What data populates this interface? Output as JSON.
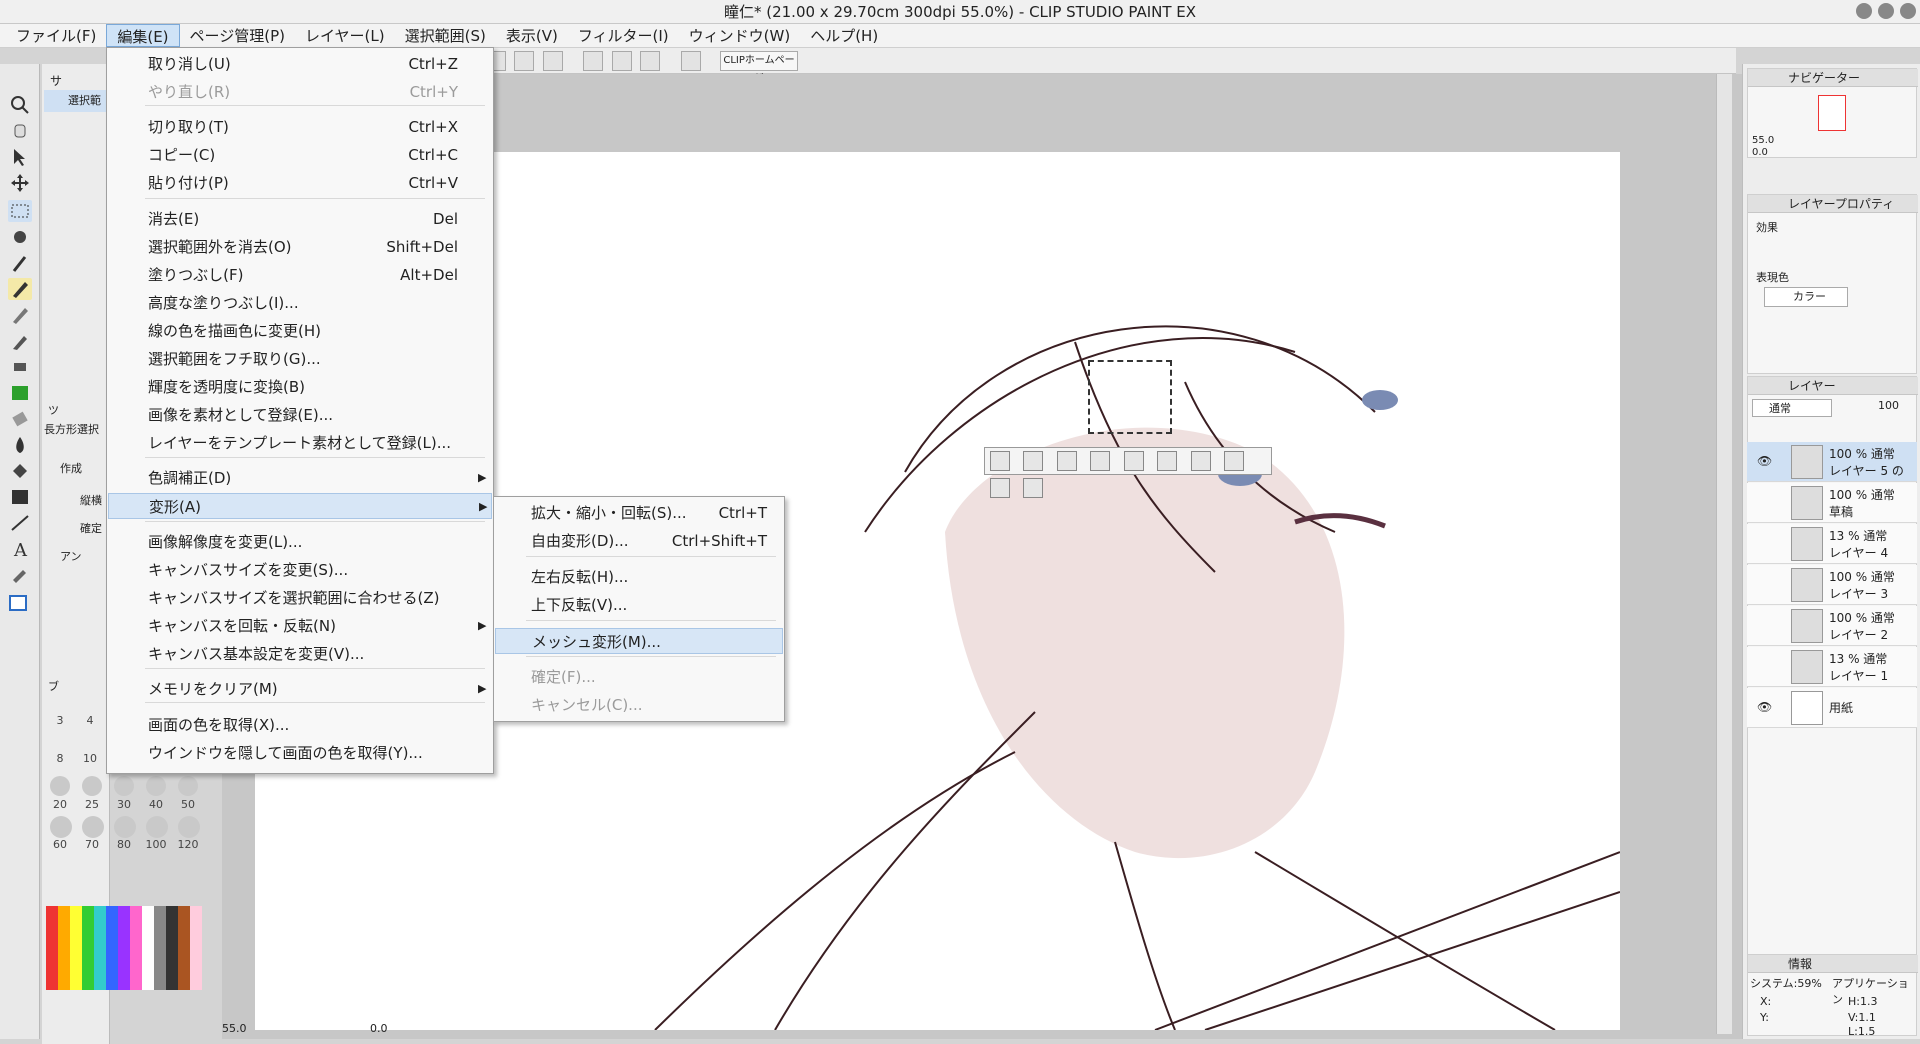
{
  "window": {
    "title": "瞳仁* (21.00 x 29.70cm 300dpi 55.0%)  - CLIP STUDIO PAINT EX"
  },
  "menubar": [
    {
      "label": "ファイル(F)"
    },
    {
      "label": "編集(E)"
    },
    {
      "label": "ページ管理(P)"
    },
    {
      "label": "レイヤー(L)"
    },
    {
      "label": "選択範囲(S)"
    },
    {
      "label": "表示(V)"
    },
    {
      "label": "フィルター(I)"
    },
    {
      "label": "ウィンドウ(W)"
    },
    {
      "label": "ヘルプ(H)"
    }
  ],
  "toolbar": {
    "clip_button": "CLIPホームページ"
  },
  "edit_menu": [
    {
      "label": "取り消し(U)",
      "shortcut": "Ctrl+Z"
    },
    {
      "label": "やり直し(R)",
      "shortcut": "Ctrl+Y"
    },
    {
      "label": "切り取り(T)",
      "shortcut": "Ctrl+X"
    },
    {
      "label": "コピー(C)",
      "shortcut": "Ctrl+C"
    },
    {
      "label": "貼り付け(P)",
      "shortcut": "Ctrl+V"
    },
    {
      "label": "消去(E)",
      "shortcut": "Del"
    },
    {
      "label": "選択範囲外を消去(O)",
      "shortcut": "Shift+Del"
    },
    {
      "label": "塗りつぶし(F)",
      "shortcut": "Alt+Del"
    },
    {
      "label": "高度な塗りつぶし(I)...",
      "shortcut": ""
    },
    {
      "label": "線の色を描画色に変更(H)",
      "shortcut": ""
    },
    {
      "label": "選択範囲をフチ取り(G)...",
      "shortcut": ""
    },
    {
      "label": "輝度を透明度に変換(B)",
      "shortcut": ""
    },
    {
      "label": "画像を素材として登録(E)...",
      "shortcut": ""
    },
    {
      "label": "レイヤーをテンプレート素材として登録(L)...",
      "shortcut": ""
    },
    {
      "label": "色調補正(D)",
      "shortcut": ""
    },
    {
      "label": "変形(A)",
      "shortcut": ""
    },
    {
      "label": "画像解像度を変更(L)...",
      "shortcut": ""
    },
    {
      "label": "キャンバスサイズを変更(S)...",
      "shortcut": ""
    },
    {
      "label": "キャンバスサイズを選択範囲に合わせる(Z)",
      "shortcut": ""
    },
    {
      "label": "キャンバスを回転・反転(N)",
      "shortcut": ""
    },
    {
      "label": "キャンバス基本設定を変更(V)...",
      "shortcut": ""
    },
    {
      "label": "メモリをクリア(M)",
      "shortcut": ""
    },
    {
      "label": "画面の色を取得(X)...",
      "shortcut": ""
    },
    {
      "label": "ウインドウを隠して画面の色を取得(Y)...",
      "shortcut": ""
    }
  ],
  "transform_menu": [
    {
      "label": "拡大・縮小・回転(S)...",
      "shortcut": "Ctrl+T"
    },
    {
      "label": "自由変形(D)...",
      "shortcut": "Ctrl+Shift+T"
    },
    {
      "label": "左右反転(H)...",
      "shortcut": ""
    },
    {
      "label": "上下反転(V)...",
      "shortcut": ""
    },
    {
      "label": "メッシュ変形(M)...",
      "shortcut": ""
    },
    {
      "label": "確定(F)...",
      "shortcut": ""
    },
    {
      "label": "キャンセル(C)...",
      "shortcut": ""
    }
  ],
  "left": {
    "sub_tab": "サ",
    "sub_item": "選択範",
    "tool_tab": "ツ",
    "tool_name": "長方形選択",
    "create_label": "作成",
    "vertical_label": "縦横",
    "confirm_label": "確定",
    "anti_label": "アン",
    "brush_tab": "ブ",
    "brush_sizes": [
      "3",
      "4",
      "8",
      "10",
      "20",
      "25",
      "30",
      "40",
      "50",
      "60",
      "70",
      "80",
      "100",
      "120"
    ],
    "zoom": "55.0",
    "angle": "0.0"
  },
  "navigator": {
    "title": "ナビゲーター",
    "zoom": "55.0",
    "angle": "0.0"
  },
  "layer_property": {
    "title": "レイヤープロパティ",
    "effect": "効果",
    "color_expr": "表現色",
    "color_value": "カラー"
  },
  "layers_panel": {
    "title": "レイヤー",
    "blend": "通常",
    "opacity": "100"
  },
  "layers": [
    {
      "pct": "100 % 通常",
      "name": "レイヤー 5 の"
    },
    {
      "pct": "100 % 通常",
      "name": "草稿"
    },
    {
      "pct": "13 % 通常",
      "name": "レイヤー 4"
    },
    {
      "pct": "100 % 通常",
      "name": "レイヤー 3"
    },
    {
      "pct": "100 % 通常",
      "name": "レイヤー 2"
    },
    {
      "pct": "13 % 通常",
      "name": "レイヤー 1"
    },
    {
      "pct": "",
      "name": "用紙"
    }
  ],
  "info": {
    "title": "情報",
    "system": "システム:59%",
    "app": "アプリケーション",
    "x": "X:",
    "y": "Y:",
    "h": "H:1.3",
    "v": "V:1.1",
    "l": "L:1.5"
  }
}
